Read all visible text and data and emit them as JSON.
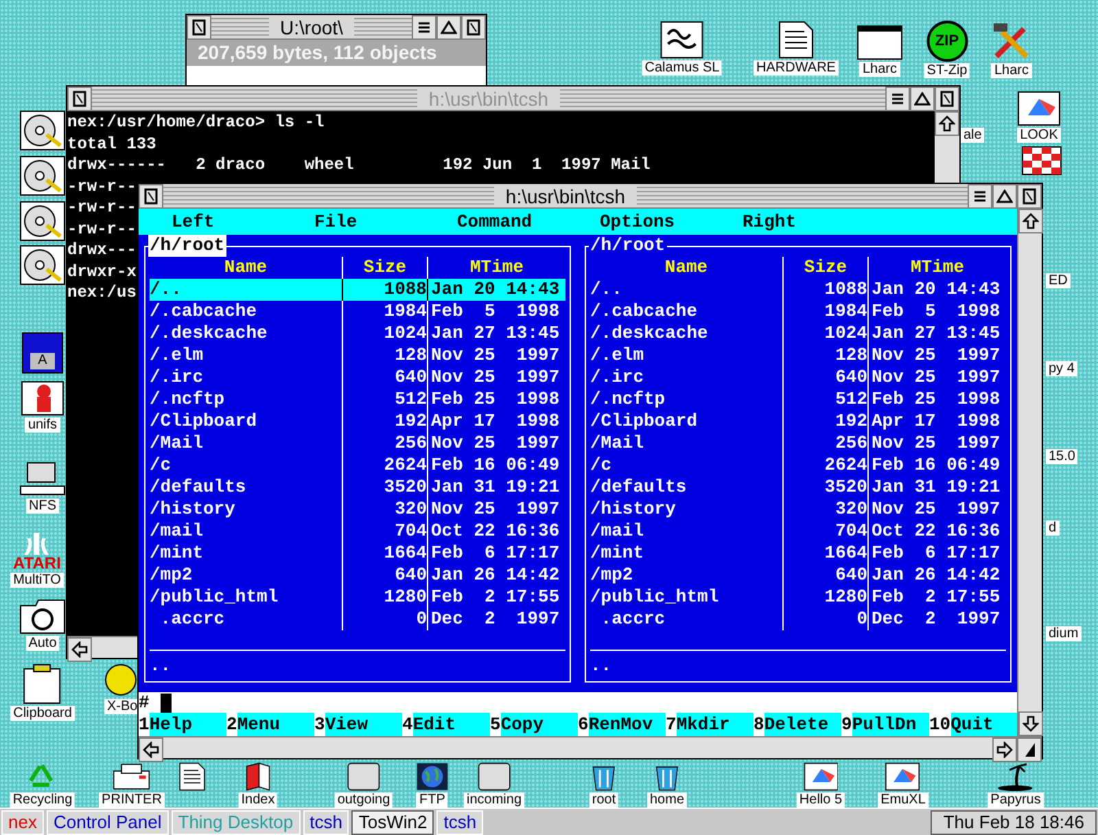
{
  "desktop_icons": [
    {
      "kind": "program",
      "label": "Calamus SL"
    },
    {
      "kind": "document",
      "label": "HARDWARE"
    },
    {
      "kind": "window",
      "label": "Lharc"
    },
    {
      "kind": "zip",
      "label": "ST-Zip",
      "badge": "ZIP"
    },
    {
      "kind": "tools",
      "label": "Lharc"
    },
    {
      "kind": "prism",
      "label": "LOOK"
    },
    {
      "kind": "partial",
      "label": "ale"
    },
    {
      "kind": "checker"
    },
    {
      "kind": "partial",
      "label": "ED"
    },
    {
      "kind": "partial",
      "label": "py 4"
    },
    {
      "kind": "partial",
      "label": "15.0"
    },
    {
      "kind": "partial",
      "label": "d"
    },
    {
      "kind": "partial",
      "label": "dium"
    },
    {
      "kind": "drive"
    },
    {
      "kind": "drive"
    },
    {
      "kind": "drive"
    },
    {
      "kind": "drive"
    },
    {
      "kind": "floppy",
      "badge": "A"
    },
    {
      "kind": "creature",
      "label": "unifs"
    },
    {
      "kind": "computer",
      "label": "NFS"
    },
    {
      "kind": "atari",
      "label": "MultiTO",
      "badge": "ATARI"
    },
    {
      "kind": "folder",
      "label": "Auto"
    },
    {
      "kind": "clipboard",
      "label": "Clipboard"
    },
    {
      "kind": "smiley",
      "label": "X-Bo"
    },
    {
      "kind": "recycle",
      "label": "Recycling"
    },
    {
      "kind": "printer",
      "label": "PRINTER"
    },
    {
      "kind": "document"
    },
    {
      "kind": "book",
      "label": "Index"
    },
    {
      "kind": "box",
      "label": "outgoing"
    },
    {
      "kind": "globe",
      "label": "FTP"
    },
    {
      "kind": "box",
      "label": "incoming"
    },
    {
      "kind": "bin",
      "label": "root"
    },
    {
      "kind": "bin",
      "label": "home"
    },
    {
      "kind": "prism",
      "label": "Hello 5"
    },
    {
      "kind": "prism",
      "label": "EmuXL"
    },
    {
      "kind": "palm",
      "label": "Papyrus"
    }
  ],
  "windows": [
    {
      "kind": "folder",
      "title": "U:\\root\\",
      "active": true,
      "info": "207,659 bytes, 112 objects"
    },
    {
      "kind": "terminal",
      "title": "h:\\usr\\bin\\tcsh",
      "active": false,
      "lines": [
        "nex:/usr/home/draco> ls -l",
        "total 133",
        "drwx------   2 draco    wheel         192 Jun  1  1997 Mail",
        "-rw-r--",
        "-rw-r--",
        "-rw-r--",
        "drwx---",
        "drwxr-x",
        "nex:/us"
      ]
    },
    {
      "kind": "filemanager",
      "title": "h:\\usr\\bin\\tcsh",
      "active": true,
      "menu": [
        "Left",
        "File",
        "Command",
        "Options",
        "Right"
      ],
      "panels": [
        {
          "path": "/h/root",
          "active": true,
          "columns": [
            "Name",
            "Size",
            "MTime"
          ],
          "status": "..",
          "rows": [
            {
              "name": "/..",
              "size": "1088",
              "mtime": "Jan 20 14:43",
              "selected": true
            },
            {
              "name": "/.cabcache",
              "size": "1984",
              "mtime": "Feb  5  1998",
              "selected": false
            },
            {
              "name": "/.deskcache",
              "size": "1024",
              "mtime": "Jan 27 13:45",
              "selected": false
            },
            {
              "name": "/.elm",
              "size": "128",
              "mtime": "Nov 25  1997",
              "selected": false
            },
            {
              "name": "/.irc",
              "size": "640",
              "mtime": "Nov 25  1997",
              "selected": false
            },
            {
              "name": "/.ncftp",
              "size": "512",
              "mtime": "Feb 25  1998",
              "selected": false
            },
            {
              "name": "/Clipboard",
              "size": "192",
              "mtime": "Apr 17  1998",
              "selected": false
            },
            {
              "name": "/Mail",
              "size": "256",
              "mtime": "Nov 25  1997",
              "selected": false
            },
            {
              "name": "/c",
              "size": "2624",
              "mtime": "Feb 16 06:49",
              "selected": false
            },
            {
              "name": "/defaults",
              "size": "3520",
              "mtime": "Jan 31 19:21",
              "selected": false
            },
            {
              "name": "/history",
              "size": "320",
              "mtime": "Nov 25  1997",
              "selected": false
            },
            {
              "name": "/mail",
              "size": "704",
              "mtime": "Oct 22 16:36",
              "selected": false
            },
            {
              "name": "/mint",
              "size": "1664",
              "mtime": "Feb  6 17:17",
              "selected": false
            },
            {
              "name": "/mp2",
              "size": "640",
              "mtime": "Jan 26 14:42",
              "selected": false
            },
            {
              "name": "/public_html",
              "size": "1280",
              "mtime": "Feb  2 17:55",
              "selected": false
            },
            {
              "name": " .accrc",
              "size": "0",
              "mtime": "Dec  2  1997",
              "selected": false
            }
          ]
        },
        {
          "path": "/h/root",
          "active": false,
          "columns": [
            "Name",
            "Size",
            "MTime"
          ],
          "status": "..",
          "rows": [
            {
              "name": "/..",
              "size": "1088",
              "mtime": "Jan 20 14:43",
              "selected": false
            },
            {
              "name": "/.cabcache",
              "size": "1984",
              "mtime": "Feb  5  1998",
              "selected": false
            },
            {
              "name": "/.deskcache",
              "size": "1024",
              "mtime": "Jan 27 13:45",
              "selected": false
            },
            {
              "name": "/.elm",
              "size": "128",
              "mtime": "Nov 25  1997",
              "selected": false
            },
            {
              "name": "/.irc",
              "size": "640",
              "mtime": "Nov 25  1997",
              "selected": false
            },
            {
              "name": "/.ncftp",
              "size": "512",
              "mtime": "Feb 25  1998",
              "selected": false
            },
            {
              "name": "/Clipboard",
              "size": "192",
              "mtime": "Apr 17  1998",
              "selected": false
            },
            {
              "name": "/Mail",
              "size": "256",
              "mtime": "Nov 25  1997",
              "selected": false
            },
            {
              "name": "/c",
              "size": "2624",
              "mtime": "Feb 16 06:49",
              "selected": false
            },
            {
              "name": "/defaults",
              "size": "3520",
              "mtime": "Jan 31 19:21",
              "selected": false
            },
            {
              "name": "/history",
              "size": "320",
              "mtime": "Nov 25  1997",
              "selected": false
            },
            {
              "name": "/mail",
              "size": "704",
              "mtime": "Oct 22 16:36",
              "selected": false
            },
            {
              "name": "/mint",
              "size": "1664",
              "mtime": "Feb  6 17:17",
              "selected": false
            },
            {
              "name": "/mp2",
              "size": "640",
              "mtime": "Jan 26 14:42",
              "selected": false
            },
            {
              "name": "/public_html",
              "size": "1280",
              "mtime": "Feb  2 17:55",
              "selected": false
            },
            {
              "name": " .accrc",
              "size": "0",
              "mtime": "Dec  2  1997",
              "selected": false
            }
          ]
        }
      ],
      "prompt": "#",
      "function_keys": [
        {
          "number": "1",
          "label": "Help"
        },
        {
          "number": "2",
          "label": "Menu"
        },
        {
          "number": "3",
          "label": "View"
        },
        {
          "number": "4",
          "label": "Edit"
        },
        {
          "number": "5",
          "label": "Copy"
        },
        {
          "number": "6",
          "label": "RenMov"
        },
        {
          "number": "7",
          "label": "Mkdir"
        },
        {
          "number": "8",
          "label": "Delete"
        },
        {
          "number": "9",
          "label": "PullDn"
        },
        {
          "number": "10",
          "label": "Quit"
        }
      ]
    }
  ],
  "taskbar": {
    "items": [
      {
        "label": "nex",
        "color": "#e00000",
        "selected": false
      },
      {
        "label": "Control Panel",
        "color": "#0000c0",
        "selected": false
      },
      {
        "label": "Thing Desktop",
        "color": "#20a0a0",
        "selected": false
      },
      {
        "label": "tcsh",
        "color": "#0000c0",
        "selected": false
      },
      {
        "label": "TosWin2",
        "color": "#000000",
        "selected": true
      },
      {
        "label": "tcsh",
        "color": "#0000c0",
        "selected": false
      }
    ],
    "clock": "Thu Feb 18 18:46"
  }
}
